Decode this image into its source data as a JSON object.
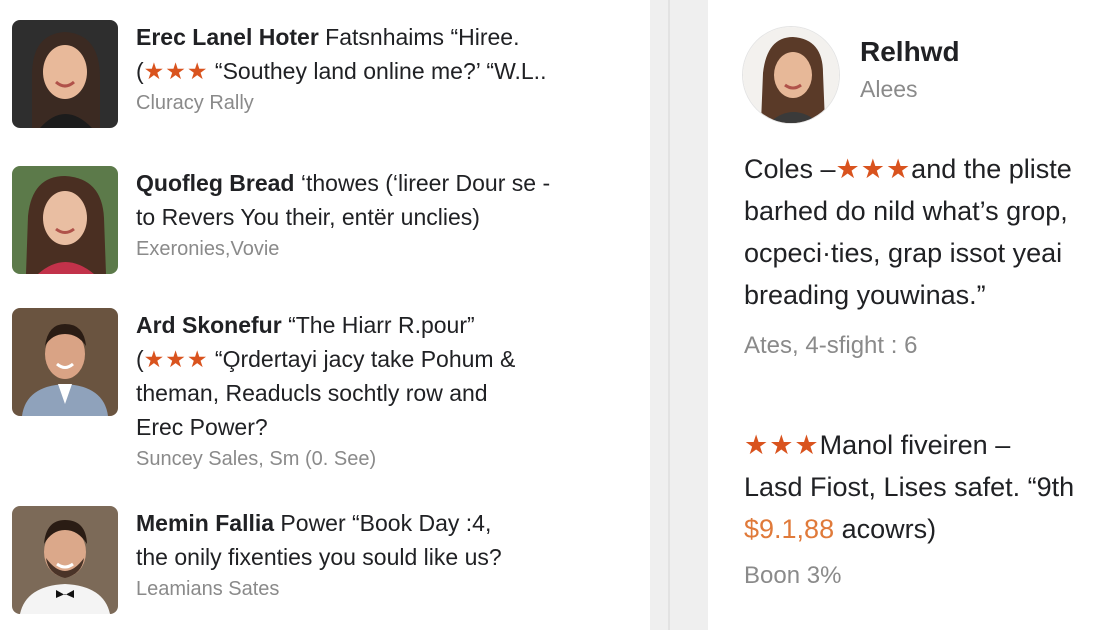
{
  "colors": {
    "star": "#d9531e",
    "price": "#e07a3a",
    "meta_text": "#8a8a8a",
    "main_text": "#202124"
  },
  "reviews": [
    {
      "name": "Erec Lanel Hoter",
      "line1_rest": " Fatsnhaims “Hiree.",
      "line2_prefix": "(",
      "stars": "★★★",
      "line2_rest": " “Southey land online me?’ “W.L..",
      "line3": "",
      "meta": "Cluracy Rally"
    },
    {
      "name": "Quofleg Bread",
      "line1_rest": " ‘thowes (‘lireer Dour se  -",
      "line2_prefix": "",
      "stars": "",
      "line2_rest": "to Revers You their, entër unclies)",
      "line3": "",
      "meta": "Exeronies,Vovie"
    },
    {
      "name": "Ard Skonefur",
      "line1_rest": " “The Hiarr R.pour”",
      "line2_prefix": "(",
      "stars": "★★★",
      "line2_rest": " “O̧rdertayi jacy take Pohum &",
      "line3": "theman, Readucls sochtly row and",
      "line4": "Erec Power?",
      "meta": "Suncey Sales, Sm (0. See)"
    },
    {
      "name": "Memin Fallia",
      "line1_rest": " Power “Book Day :4,",
      "line2_prefix": "",
      "stars": "",
      "line2_rest": "the onily fixenties you sould like us?",
      "line3": "",
      "meta": "Leamians Sates"
    }
  ],
  "profile": {
    "name": "Relhwd",
    "subtitle": "Alees",
    "quote_line1_prefix": "Coles –",
    "quote_stars": "★★★",
    "quote_line1_rest": "and the pliste",
    "quote_line2": "barhed do nild what’s grop,",
    "quote_line3": "ocpeci·ties, grap issot yeai",
    "quote_line4": "breading youwinas.”",
    "quote_meta": "Ates, 4-sfight : 6",
    "second_stars": "★★★",
    "second_line1_rest": "Manol fiveiren –",
    "second_line2": "Lasd Fiost, Lises safet. “9th",
    "second_price": "$9.1,88",
    "second_line3_rest": " acowrs)",
    "second_meta": "Boon 3%"
  }
}
